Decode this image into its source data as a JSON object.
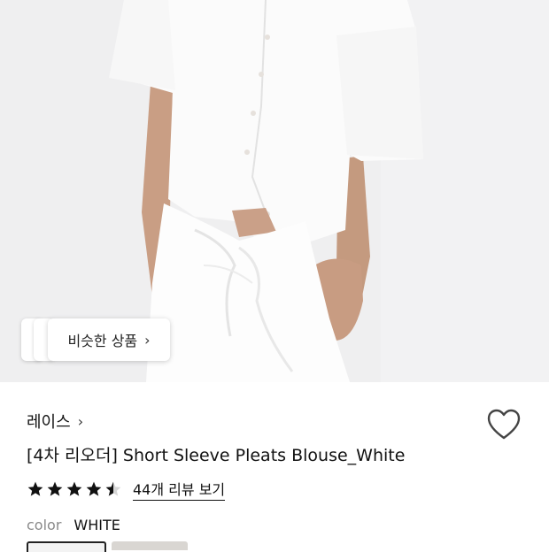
{
  "hero": {
    "similar_label": "비슷한 상품",
    "similar_chevron": "›"
  },
  "product": {
    "brand": "레이스",
    "brand_chevron": "›",
    "title": "[4차 리오더] Short Sleeve Pleats Blouse_White",
    "rating": 4.5,
    "reviews_label": "44개 리뷰 보기",
    "color_label": "color",
    "color_value": "WHITE"
  },
  "icons": {
    "wishlist": "heart-outline-icon",
    "similar_arrow": "chevron-right-icon",
    "brand_arrow": "chevron-right-icon"
  },
  "colors": {
    "text": "#111111",
    "muted": "#8a8a8a",
    "star": "#111111"
  }
}
